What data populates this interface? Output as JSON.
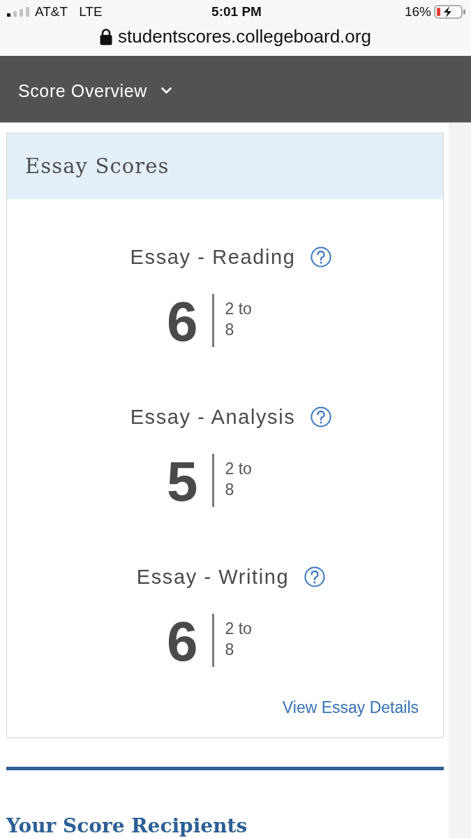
{
  "status_bar": {
    "carrier": "AT&T",
    "network": "LTE",
    "time": "5:01 PM",
    "battery": "16%"
  },
  "address_bar": {
    "url": "studentscores.collegeboard.org"
  },
  "nav": {
    "title": "Score Overview"
  },
  "essay_scores": {
    "title": "Essay Scores",
    "scores": [
      {
        "label": "Essay - Reading",
        "score": "6",
        "range": "2 to 8"
      },
      {
        "label": "Essay - Analysis",
        "score": "5",
        "range": "2 to 8"
      },
      {
        "label": "Essay - Writing",
        "score": "6",
        "range": "2 to 8"
      }
    ],
    "link": "View Essay Details"
  },
  "recipients": {
    "title": "Your Score Recipients"
  }
}
